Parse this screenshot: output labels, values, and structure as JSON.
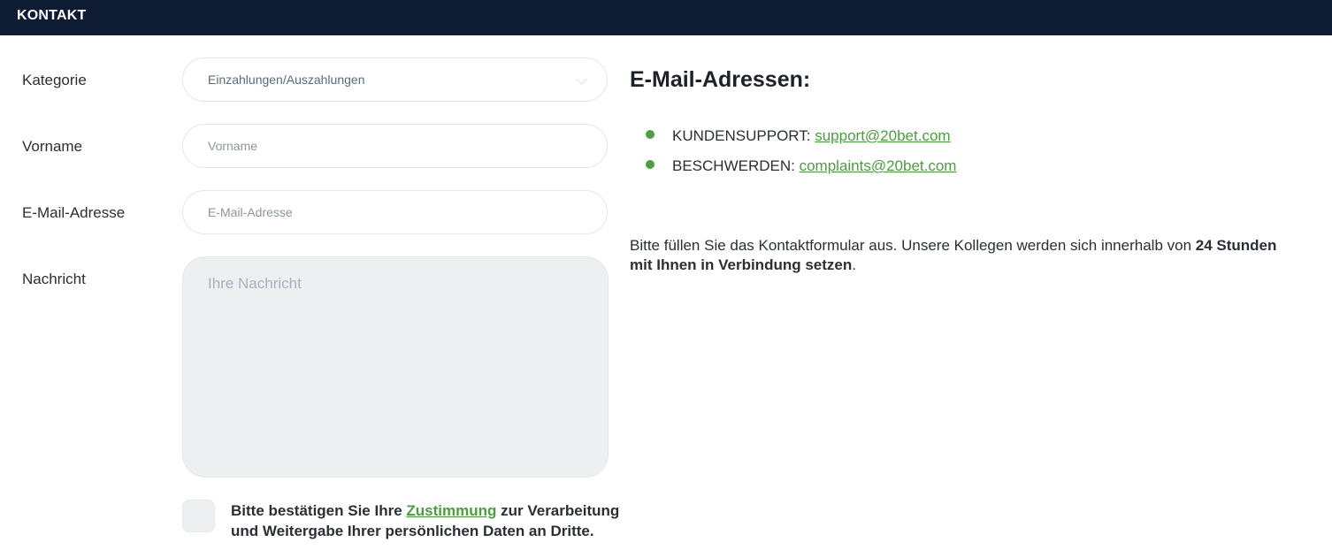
{
  "header": {
    "title": "KONTAKT"
  },
  "form": {
    "category": {
      "label": "Kategorie",
      "value": "Einzahlungen/Auszahlungen"
    },
    "firstname": {
      "label": "Vorname",
      "placeholder": "Vorname",
      "value": ""
    },
    "email": {
      "label": "E-Mail-Adresse",
      "placeholder": "E-Mail-Adresse",
      "value": ""
    },
    "message": {
      "label": "Nachricht",
      "placeholder": "Ihre Nachricht",
      "value": ""
    },
    "consent": {
      "checked": false,
      "text_before": "Bitte bestätigen Sie Ihre ",
      "link_text": "Zustimmung",
      "text_after": " zur Verarbeitung und Weitergabe Ihrer persönlichen Daten an Dritte."
    }
  },
  "contact": {
    "heading": "E-Mail-Adressen:",
    "items": [
      {
        "label": "KUNDENSUPPORT: ",
        "email": "support@20bet.com"
      },
      {
        "label": "BESCHWERDEN: ",
        "email": "complaints@20bet.com"
      }
    ],
    "info_before": "Bitte füllen Sie das Kontaktformular aus. Unsere Kollegen werden sich innerhalb von ",
    "info_bold": "24 Stunden mit Ihnen in Verbindung setzen",
    "info_after": "."
  },
  "colors": {
    "header_bg": "#0d1b33",
    "accent": "#47a03a",
    "textarea_bg": "#edf0f1"
  }
}
